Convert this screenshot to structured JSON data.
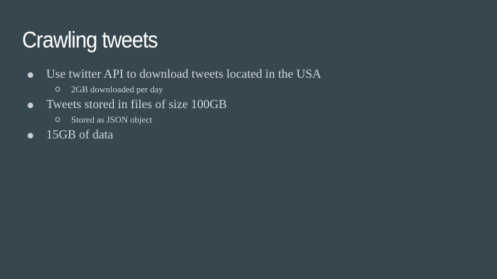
{
  "slide": {
    "title": "Crawling tweets",
    "bullets": [
      "Use twitter API to download tweets located in the USA",
      "2GB downloaded per day",
      "Tweets stored in files of size 100GB",
      "Stored as JSON object",
      "15GB of data"
    ],
    "colors": {
      "background": "#37474f",
      "title": "#ffffff",
      "body": "#d0d6d9"
    }
  }
}
